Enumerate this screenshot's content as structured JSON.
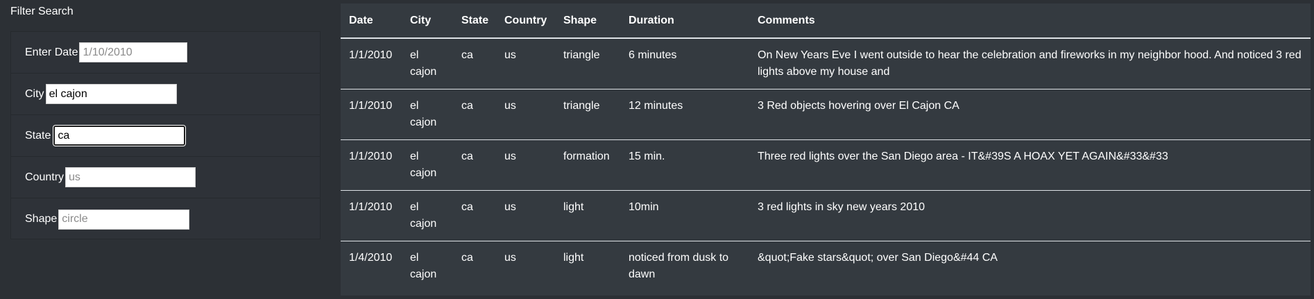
{
  "filter": {
    "title": "Filter Search",
    "fields": [
      {
        "label": "Enter Date",
        "value": "",
        "placeholder": "1/10/2010"
      },
      {
        "label": "City",
        "value": "el cajon",
        "placeholder": ""
      },
      {
        "label": "State",
        "value": "ca",
        "placeholder": ""
      },
      {
        "label": "Country",
        "value": "",
        "placeholder": "us"
      },
      {
        "label": "Shape",
        "value": "",
        "placeholder": "circle"
      }
    ]
  },
  "table": {
    "headers": [
      "Date",
      "City",
      "State",
      "Country",
      "Shape",
      "Duration",
      "Comments"
    ],
    "rows": [
      {
        "date": "1/1/2010",
        "city": "el cajon",
        "state": "ca",
        "country": "us",
        "shape": "triangle",
        "duration": "6 minutes",
        "comments": "On New Years Eve I went outside to hear the celebration and fireworks in my neighbor hood. And noticed 3 red lights above my house and"
      },
      {
        "date": "1/1/2010",
        "city": "el cajon",
        "state": "ca",
        "country": "us",
        "shape": "triangle",
        "duration": "12 minutes",
        "comments": "3 Red objects hovering over El Cajon CA"
      },
      {
        "date": "1/1/2010",
        "city": "el cajon",
        "state": "ca",
        "country": "us",
        "shape": "formation",
        "duration": "15 min.",
        "comments": "Three red lights over the San Diego area - IT&#39S A HOAX YET AGAIN&#33&#33"
      },
      {
        "date": "1/1/2010",
        "city": "el cajon",
        "state": "ca",
        "country": "us",
        "shape": "light",
        "duration": "10min",
        "comments": "3 red lights in sky new years 2010"
      },
      {
        "date": "1/4/2010",
        "city": "el cajon",
        "state": "ca",
        "country": "us",
        "shape": "light",
        "duration": "noticed from dusk to dawn",
        "comments": "&quot;Fake stars&quot; over San Diego&#44 CA"
      }
    ]
  }
}
